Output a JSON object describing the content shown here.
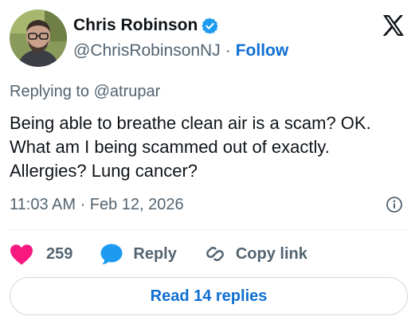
{
  "author": {
    "display_name": "Chris Robinson",
    "handle": "@ChrisRobinsonNJ",
    "separator": "·",
    "follow_label": "Follow",
    "verified": true
  },
  "platform_icon": "x-logo-icon",
  "reply_context": "Replying to @atrupar",
  "tweet": {
    "text": "Being able to breathe clean air is a scam? OK. What am I being scammed out of exactly. Allergies? Lung cancer?",
    "timestamp": "11:03 AM · Feb 12, 2026"
  },
  "actions": {
    "likes_count": "259",
    "reply_label": "Reply",
    "copy_link_label": "Copy link"
  },
  "read_replies_label": "Read 14 replies",
  "colors": {
    "accent": "#0f6fd3",
    "like": "#f91880",
    "reply_bubble": "#1d9bf0",
    "verified": "#1d9bf0",
    "secondary_text": "#536471"
  }
}
